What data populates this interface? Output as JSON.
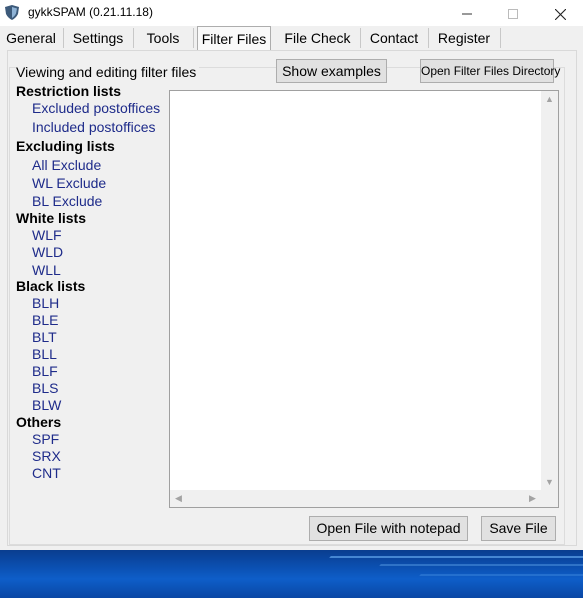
{
  "window": {
    "title": "gykkSPAM  (0.21.11.18)",
    "minimize_icon": "minimize-icon",
    "maximize_icon": "maximize-icon",
    "close_icon": "close-icon",
    "accent": "#1e2b8a"
  },
  "tabs": [
    {
      "label": "General"
    },
    {
      "label": "Settings"
    },
    {
      "label": "Tools"
    },
    {
      "label": "Filter Files",
      "active": true
    },
    {
      "label": "File Check"
    },
    {
      "label": "Contact"
    },
    {
      "label": "Register"
    }
  ],
  "filter_files": {
    "group_label": "Viewing and editing filter files",
    "show_examples_label": "Show examples",
    "open_dir_label": "Open Filter Files Directory",
    "open_notepad_label": "Open File with notepad",
    "save_file_label": "Save File",
    "editor_content": "",
    "sections": [
      {
        "heading": "Restriction lists",
        "items": [
          "Excluded postoffices",
          "Included postoffices"
        ]
      },
      {
        "heading": "Excluding lists",
        "items": [
          "All Exclude",
          "WL Exclude",
          "BL Exclude"
        ]
      },
      {
        "heading": "White lists",
        "items": [
          "WLF",
          "WLD",
          "WLL"
        ]
      },
      {
        "heading": "Black lists",
        "items": [
          "BLH",
          "BLE",
          "BLT",
          "BLL",
          "BLF",
          "BLS",
          "BLW"
        ]
      },
      {
        "heading": "Others",
        "items": [
          "SPF",
          "SRX",
          "CNT"
        ]
      }
    ]
  }
}
